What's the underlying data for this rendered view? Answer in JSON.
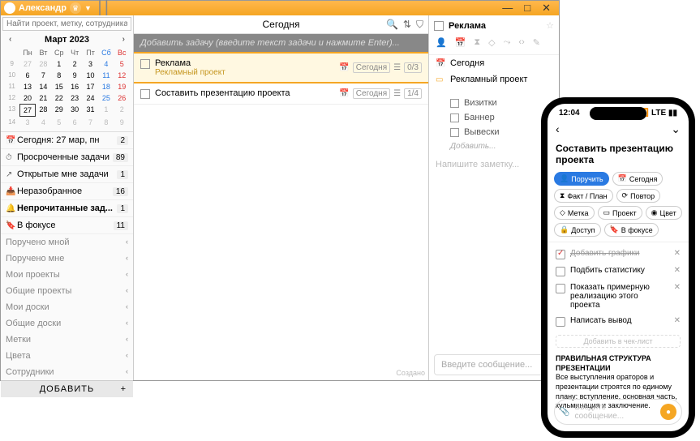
{
  "titlebar": {
    "user": "Александр"
  },
  "window": {
    "min": "—",
    "max": "□",
    "close": "✕"
  },
  "search_placeholder": "Найти проект, метку, сотрудника, контакт",
  "calendar": {
    "title": "Март 2023",
    "dow": [
      "Пн",
      "Вт",
      "Ср",
      "Чт",
      "Пт",
      "Сб",
      "Вс"
    ],
    "weeks": [
      {
        "wk": "9",
        "days": [
          "27",
          "28",
          "1",
          "2",
          "3",
          "4",
          "5"
        ]
      },
      {
        "wk": "10",
        "days": [
          "6",
          "7",
          "8",
          "9",
          "10",
          "11",
          "12"
        ]
      },
      {
        "wk": "11",
        "days": [
          "13",
          "14",
          "15",
          "16",
          "17",
          "18",
          "19"
        ]
      },
      {
        "wk": "12",
        "days": [
          "20",
          "21",
          "22",
          "23",
          "24",
          "25",
          "26"
        ]
      },
      {
        "wk": "13",
        "days": [
          "27",
          "28",
          "29",
          "30",
          "31",
          "1",
          "2"
        ]
      },
      {
        "wk": "14",
        "days": [
          "3",
          "4",
          "5",
          "6",
          "7",
          "8",
          "9"
        ]
      }
    ],
    "today": "27"
  },
  "nav": [
    {
      "icon": "📅",
      "label": "Сегодня: 27 мар, пн",
      "count": "2"
    },
    {
      "icon": "⏱",
      "label": "Просроченные задачи",
      "count": "89"
    },
    {
      "icon": "↗",
      "label": "Открытые мне задачи",
      "count": "1"
    },
    {
      "icon": "📥",
      "label": "Неразобранное",
      "count": "16"
    },
    {
      "icon": "🔔",
      "label": "Непрочитанные зад...",
      "count": "1",
      "bold": true
    },
    {
      "icon": "🔖",
      "label": "В фокусе",
      "count": "11",
      "red": true
    }
  ],
  "sections": [
    "Поручено мной",
    "Поручено мне",
    "Мои проекты",
    "Общие проекты",
    "Мои доски",
    "Общие доски",
    "Метки",
    "Цвета",
    "Сотрудники"
  ],
  "add_button": "ДОБАВИТЬ",
  "center": {
    "title": "Сегодня",
    "addtask": "Добавить задачу (введите текст задачи и нажмите Enter)...",
    "tasks": [
      {
        "title": "Реклама",
        "sub": "Рекламный проект",
        "date": "Сегодня",
        "prog": "0/3",
        "sel": true
      },
      {
        "title": "Составить презентацию проекта",
        "date": "Сегодня",
        "prog": "1/4"
      }
    ],
    "created": "Создано"
  },
  "right": {
    "title": "Реклама",
    "back": [
      "Сегодня",
      "Рекламный проект"
    ],
    "items": [
      "Визитки",
      "Баннер",
      "Вывески"
    ],
    "add": "Добавить...",
    "note": "Напишите заметку...",
    "msg": "Введите сообщение..."
  },
  "phone": {
    "time": "12:04",
    "signal": "📶 LTE ▮▮",
    "title": "Составить презентацию проекта",
    "chips": [
      {
        "t": "Поручить",
        "p": true,
        "i": "👤"
      },
      {
        "t": "Сегодня",
        "i": "📅"
      },
      {
        "t": "Факт / План",
        "i": "⧗"
      },
      {
        "t": "Повтор",
        "i": "⟳"
      },
      {
        "t": "Метка",
        "i": "◇"
      },
      {
        "t": "Проект",
        "i": "▭"
      },
      {
        "t": "Цвет",
        "i": "◉"
      },
      {
        "t": "Доступ",
        "i": "🔒"
      },
      {
        "t": "В фокусе",
        "i": "🔖"
      }
    ],
    "checks": [
      {
        "t": "Добавить графики",
        "done": true
      },
      {
        "t": "Подбить статистику"
      },
      {
        "t": "Показать примерную реализацию этого проекта"
      },
      {
        "t": "Написать вывод"
      }
    ],
    "addcheck": "Добавить в чек-лист",
    "note_title": "ПРАВИЛЬНАЯ СТРУКТУРА ПРЕЗЕНТАЦИИ",
    "note_body": "Все выступления ораторов и презентации строятся по единому плану: вступление, основная часть, кульминация и заключение.",
    "input": "Введите сообщение..."
  }
}
